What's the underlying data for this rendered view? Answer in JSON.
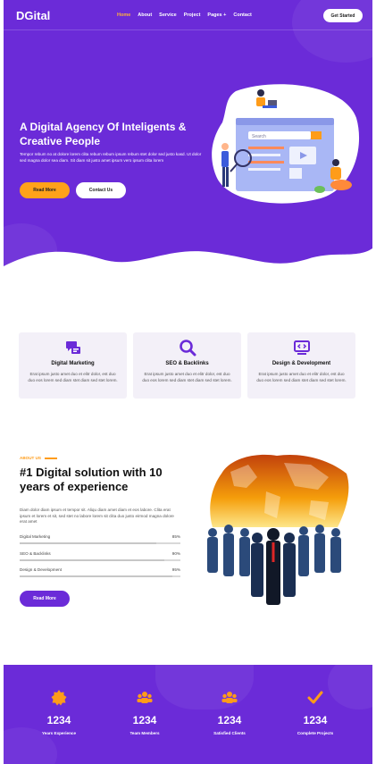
{
  "nav": {
    "brand": "DGital",
    "items": [
      "Home",
      "About",
      "Service",
      "Project",
      "Pages +",
      "Contact"
    ],
    "active_index": 0,
    "cta": "Get Started"
  },
  "hero": {
    "title": "A Digital Agency Of Inteligents & Creative People",
    "text": "Tempor rebum no at dolore lorem clita rebum rebum ipsum rebum stet dolor sed justo kasd. Ut dolor sed magna dolor sea diam. Sit diam sit justo amet ipsum vero ipsum clita lorem",
    "read_more": "Read More",
    "contact": "Contact Us",
    "illustration_search": "Search"
  },
  "services": [
    {
      "icon": "megaphone-icon",
      "title": "Digital Marketing",
      "text": "Erat ipsum justo amet duo et elitr dolor, est duo duo eos lorem sed diam stet diam sed stet lorem."
    },
    {
      "icon": "search-icon",
      "title": "SEO & Backlinks",
      "text": "Erat ipsum justo amet duo et elitr dolor, est duo duo eos lorem sed diam stet diam sed stet lorem."
    },
    {
      "icon": "code-monitor-icon",
      "title": "Design & Development",
      "text": "Erat ipsum justo amet duo et elitr dolor, est duo duo eos lorem sed diam stet diam sed stet lorem."
    }
  ],
  "about": {
    "label": "ABOUT US",
    "title": "#1 Digital solution with 10 years of experience",
    "text": "Diam dolor diam ipsum et tempor sit. Aliqu diam amet diam et eos labore. Clita erat ipsum et lorem et sit, sed stet no labore lorem sit clita duo justo eirmod magna dolore erat amet",
    "skills": [
      {
        "label": "Digital Marketing",
        "value": "85%",
        "level": 0.85
      },
      {
        "label": "SEO & Backlinks",
        "value": "90%",
        "level": 0.9
      },
      {
        "label": "Design & Development",
        "value": "95%",
        "level": 0.95
      }
    ],
    "read_more": "Read More"
  },
  "stats": [
    {
      "icon": "award-icon",
      "number": "1234",
      "label": "Years Experience"
    },
    {
      "icon": "users-icon",
      "number": "1234",
      "label": "Team Members"
    },
    {
      "icon": "users-icon",
      "number": "1234",
      "label": "Satisfied Clients"
    },
    {
      "icon": "check-icon",
      "number": "1234",
      "label": "Complete Projects"
    }
  ],
  "colors": {
    "primary": "#6b2bd8",
    "accent": "#ffa21a",
    "card_bg": "#f3f0f8"
  }
}
